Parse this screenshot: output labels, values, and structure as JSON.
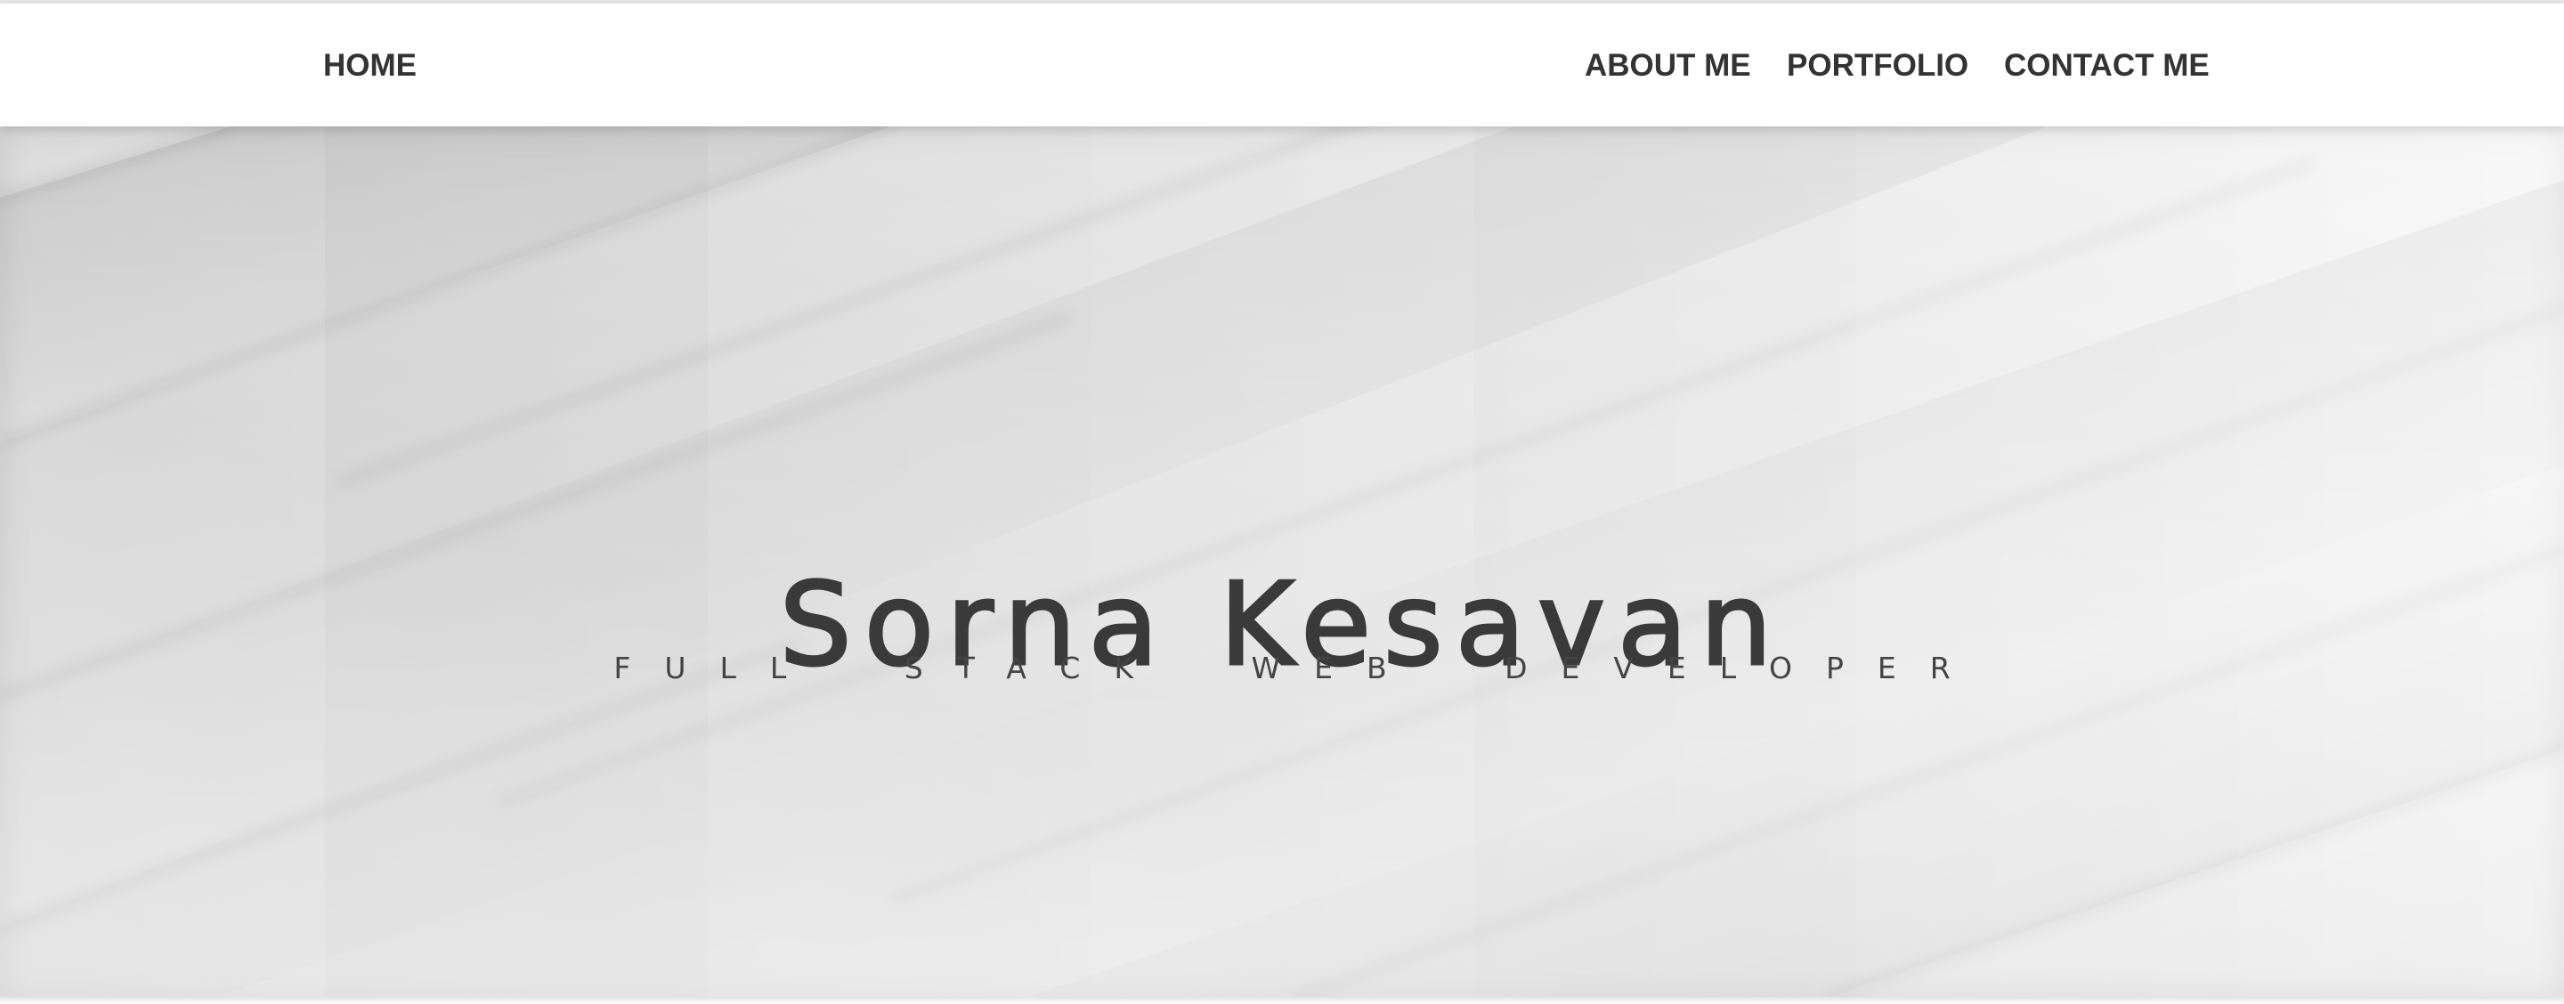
{
  "nav": {
    "home_label": "HOME",
    "about_label": "ABOUT ME",
    "portfolio_label": "PORTFOLIO",
    "contact_label": "CONTACT ME"
  },
  "hero": {
    "name": "Sorna Kesavan",
    "tagline": "FULL STACK WEB DEVELOPER"
  }
}
